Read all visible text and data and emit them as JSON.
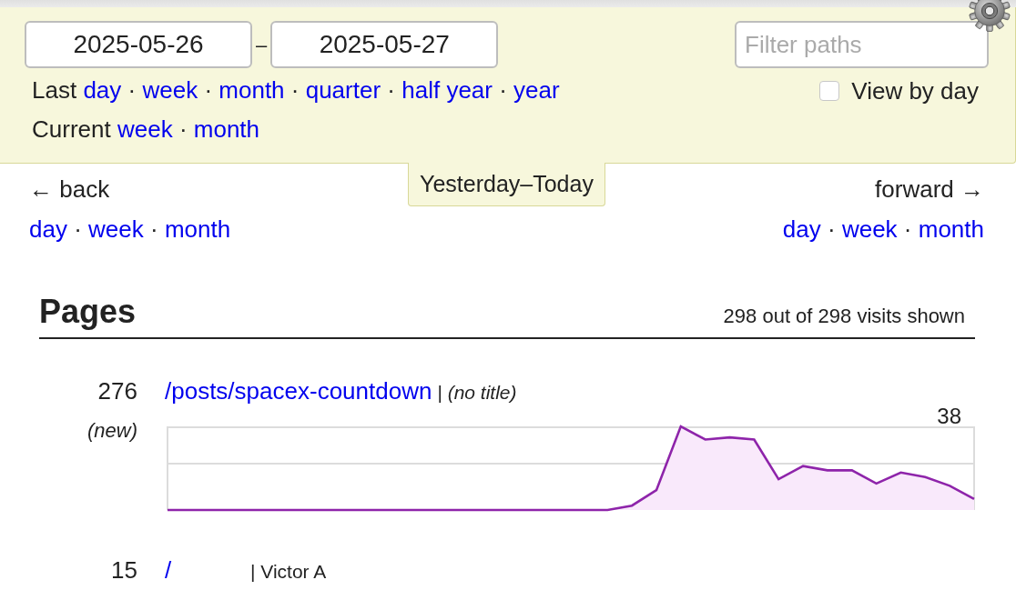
{
  "date_range": {
    "start": "2025-05-26",
    "separator": "–",
    "end": "2025-05-27"
  },
  "filter": {
    "placeholder": "Filter paths"
  },
  "last_periods": {
    "label": "Last",
    "separator": "·",
    "links": [
      "day",
      "week",
      "month",
      "quarter",
      "half year",
      "year"
    ]
  },
  "view_by_day": {
    "label": "View by day",
    "checked": false
  },
  "current_periods": {
    "label": "Current",
    "separator": "·",
    "links": [
      "week",
      "month"
    ]
  },
  "period_tab": {
    "label": "Yesterday–Today"
  },
  "back": {
    "label": "← back",
    "separator": "·",
    "links": [
      "day",
      "week",
      "month"
    ]
  },
  "forward": {
    "label": "forward →",
    "separator": "·",
    "links": [
      "day",
      "week",
      "month"
    ]
  },
  "pages": {
    "title": "Pages",
    "summary": "298 out of 298 visits shown",
    "rows": [
      {
        "count": "276",
        "note": "(new)",
        "path": "/posts/spacex-countdown",
        "title": "| *(no title)*",
        "sparkline": {
          "max_label": "38"
        }
      },
      {
        "count": "15",
        "path": "/",
        "title": "| Victor A"
      }
    ]
  }
}
